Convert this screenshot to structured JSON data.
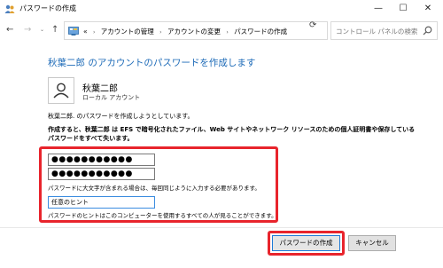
{
  "window": {
    "title": "パスワードの作成",
    "min_glyph": "—",
    "max_glyph": "☐",
    "close_glyph": "✕"
  },
  "nav": {
    "back_glyph": "←",
    "forward_glyph": "→",
    "dropdown_glyph": "⌄",
    "up_glyph": "↑",
    "refresh_glyph": "⟳",
    "overflow": "«",
    "separator": "›",
    "breadcrumbs": [
      "アカウントの管理",
      "アカウントの変更",
      "パスワードの作成"
    ],
    "search_placeholder": "コントロール パネルの検索"
  },
  "main": {
    "heading": "秋葉二郎 のアカウントのパスワードを作成します",
    "user_name": "秋葉二郎",
    "user_type": "ローカル アカウント",
    "intro": "秋葉二郎. のパスワードを作成しようとしています。",
    "warning": "作成すると、秋葉二郎 は EFS で暗号化されたファイル、Web サイトやネットワーク リソースのための個人証明書や保存しているパスワードをすべて失います。",
    "new_password": "●●●●●●●●●●●",
    "confirm_password": "●●●●●●●●●●●",
    "caps_note": "パスワードに大文字が含まれる場合は、毎回同じように入力する必要があります。",
    "hint_value": "任意のヒント",
    "hint_note": "パスワードのヒントはこのコンピューターを使用するすべての人が見ることができます。"
  },
  "buttons": {
    "create": "パスワードの作成",
    "cancel": "キャンセル"
  },
  "colors": {
    "heading": "#1e6bb8",
    "highlight": "#e8242c",
    "focus": "#3c8de0"
  }
}
